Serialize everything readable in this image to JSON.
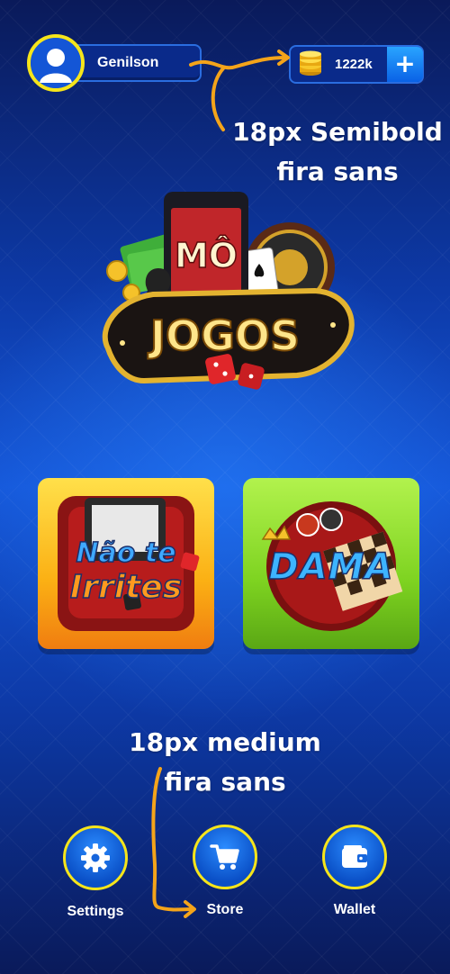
{
  "profile": {
    "name": "Genilson",
    "avatar_icon": "user-avatar-icon"
  },
  "wallet_balance": {
    "amount": "1222k",
    "coin_icon": "coin-stack-icon",
    "add_label": "+"
  },
  "annotations": {
    "top": [
      "18px Semibold",
      "fira sans"
    ],
    "bottom": [
      "18px medium",
      "fira sans"
    ]
  },
  "logo": {
    "top_text": "MÔ",
    "main_text": "JOGOS",
    "icon": "mo-jogos-logo"
  },
  "games": [
    {
      "title_line1": "Não te",
      "title_line2": "Irrites",
      "icon": "ludo-board-icon"
    },
    {
      "title": "DAMA",
      "icon": "checkers-board-icon"
    }
  ],
  "nav": [
    {
      "label": "Settings",
      "icon": "gear-icon"
    },
    {
      "label": "Store",
      "icon": "cart-icon"
    },
    {
      "label": "Wallet",
      "icon": "wallet-icon"
    }
  ],
  "colors": {
    "accent_yellow": "#f6e51a",
    "annotation_arrow": "#f4a41a",
    "pill_bg": "#0a2a8a",
    "card_yellow": "#fbb014",
    "card_green": "#7ed321"
  }
}
